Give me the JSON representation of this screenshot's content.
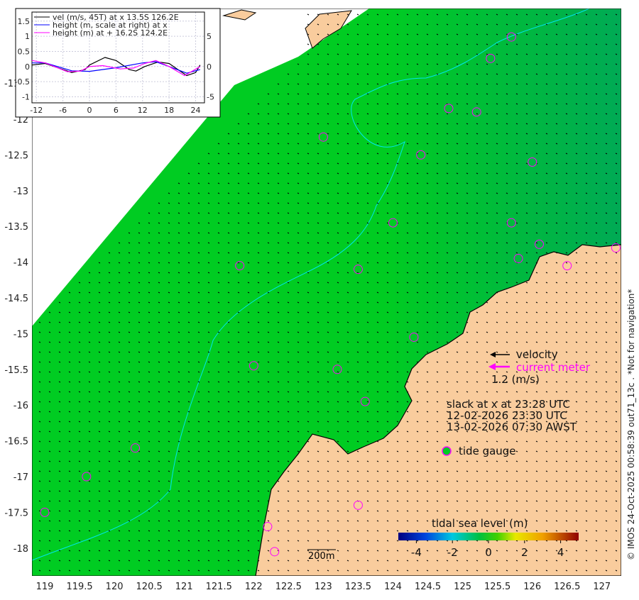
{
  "map": {
    "lon_ticks": [
      "119",
      "119.5",
      "120",
      "120.5",
      "121",
      "121.5",
      "122",
      "122.5",
      "123",
      "123.5",
      "124",
      "124.5",
      "125",
      "125.5",
      "126",
      "126.5",
      "127"
    ],
    "lat_ticks": [
      "-12",
      "-12.5",
      "-13",
      "-13.5",
      "-14",
      "-14.5",
      "-15",
      "-15.5",
      "-16",
      "-16.5",
      "-17",
      "-17.5",
      "-18"
    ],
    "partial_lat_tick": "-11",
    "scale_bar": "200m",
    "colors": {
      "sea": "#00cc22",
      "land": "#f9cc9d",
      "contour": "#00e5ee",
      "gauge": "#ff00ff"
    }
  },
  "legend": {
    "velocity": "velocity",
    "current_meter": "current meter",
    "arrow_scale": "1.2 (m/s)",
    "slack": "slack at x at 23:28 UTC",
    "utc_time": "12-02-2026 23:30 UTC",
    "local_time": "13-02-2026 07:30 AWST",
    "tide_gauge": "tide gauge"
  },
  "colorbar": {
    "title": "tidal sea level (m)",
    "ticks": [
      "-4",
      "-2",
      "0",
      "2",
      "4"
    ],
    "range": [
      -5,
      5
    ]
  },
  "credit": "© IMOS 24-Oct-2025 00:58:39 out71_13c . *Not for navigation*",
  "chart_data": {
    "type": "line",
    "x_ticks": [
      "-12",
      "-6",
      "0",
      "6",
      "12",
      "18",
      "24"
    ],
    "y_left_ticks": [
      "1.5",
      "1",
      "0.5",
      "0",
      "-0.5",
      "-1"
    ],
    "y_right_ticks": [
      "5",
      "0",
      "-5"
    ],
    "xlim": [
      -13,
      26
    ],
    "ylim_left": [
      -1.2,
      1.8
    ],
    "ylim_right": [
      -6,
      9
    ],
    "grid": true,
    "legend_position": "top",
    "series": [
      {
        "name": "vel (m/s, 45T) at x 13.5S 126.2E",
        "color": "#000000",
        "axis": "left",
        "x": [
          -13,
          -10,
          -8,
          -4,
          -1,
          0,
          3.5,
          6,
          9,
          10.5,
          12.5,
          15.5,
          18,
          20,
          22,
          24,
          25
        ],
        "y": [
          0.05,
          0.1,
          0,
          -0.2,
          -0.1,
          0.05,
          0.3,
          0.2,
          -0.1,
          -0.15,
          0,
          0.15,
          0.1,
          -0.1,
          -0.3,
          -0.2,
          0.05
        ]
      },
      {
        "name": "height (m, scale at right) at x",
        "color": "#0000ff",
        "axis": "right",
        "x": [
          -13,
          -10,
          -4,
          0,
          6,
          12,
          15,
          18,
          22,
          25
        ],
        "y": [
          0.6,
          0.6,
          -0.7,
          -0.8,
          -0.2,
          0.6,
          0.8,
          0,
          -1.1,
          -0.5
        ]
      },
      {
        "name": "height (m) at + 16.2S 124.2E",
        "color": "#ff00ff",
        "axis": "left",
        "x": [
          -13,
          -10,
          -5,
          -2,
          0,
          3,
          7,
          10,
          12.5,
          15,
          18,
          21.5,
          25
        ],
        "y": [
          0.2,
          0.12,
          -0.17,
          -0.15,
          0,
          0.03,
          -0.08,
          -0.05,
          0.1,
          0.2,
          0,
          -0.3,
          0
        ]
      }
    ]
  }
}
